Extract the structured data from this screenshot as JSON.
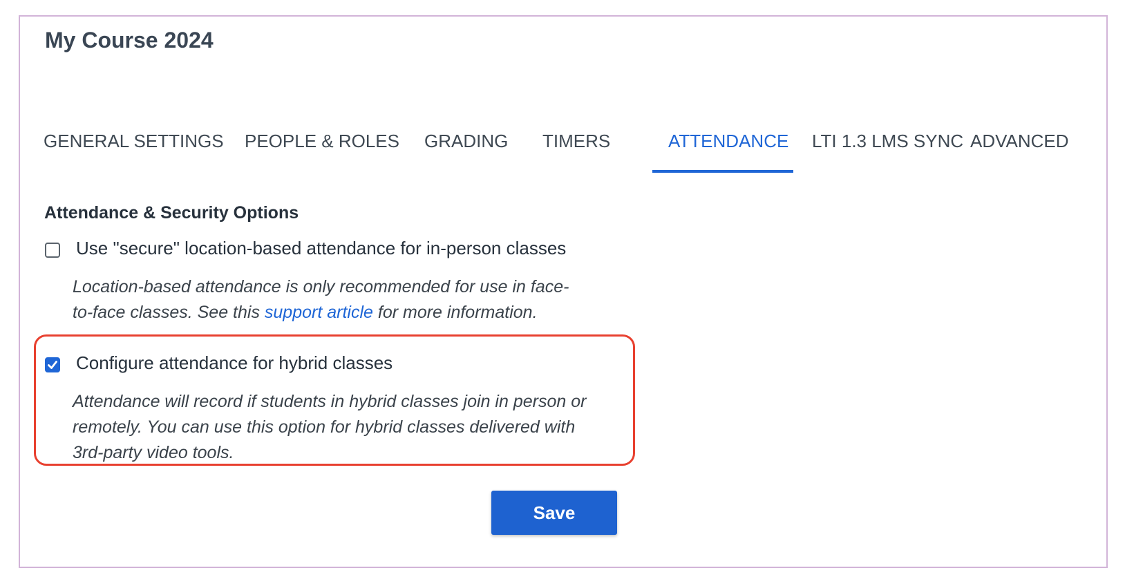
{
  "course": {
    "title": "My Course 2024"
  },
  "tabs": [
    {
      "label": "GENERAL SETTINGS",
      "active": false
    },
    {
      "label": "PEOPLE & ROLES",
      "active": false
    },
    {
      "label": "GRADING",
      "active": false
    },
    {
      "label": "TIMERS",
      "active": false
    },
    {
      "label": "ATTENDANCE",
      "active": true
    },
    {
      "label": "LTI 1.3 LMS SYNC",
      "active": false
    },
    {
      "label": "ADVANCED",
      "active": false
    }
  ],
  "section": {
    "heading": "Attendance & Security Options"
  },
  "options": [
    {
      "label": "Use \"secure\" location-based attendance for in-person classes",
      "checked": false,
      "help_line1": "Location-based attendance is only recommended for use in face-",
      "help_line2_pre": "to-face classes. See this ",
      "help_link": "support article",
      "help_line2_post": " for more information."
    },
    {
      "label": "Configure attendance for hybrid classes",
      "checked": true,
      "help_line1": "Attendance will record if students in hybrid classes join in person or",
      "help_line2": "remotely. You can use this option for hybrid classes delivered with",
      "help_line3": "3rd-party video tools."
    }
  ],
  "actions": {
    "save_label": "Save"
  },
  "colors": {
    "accent": "#1f66d6",
    "highlight": "#e8402f",
    "frame_border": "#d2b4d8"
  }
}
